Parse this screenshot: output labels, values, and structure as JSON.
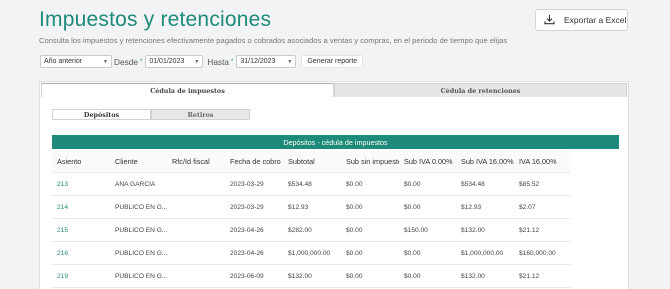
{
  "header": {
    "title": "Impuestos y retenciones",
    "subtitle": "Consulta los impuestos y retenciones efectivamente pagados o cobrados asociados a ventas y compras, en el periodo de tiempo que elijas",
    "export_label": "Exportar a Excel"
  },
  "filters": {
    "period_value": "Año anterior",
    "desde_label": "Desde",
    "desde_value": "01/01/2023",
    "hasta_label": "Hasta",
    "hasta_value": "31/12/2023",
    "required_mark": "*",
    "generate_label": "Generar reporte"
  },
  "tabs": [
    {
      "label": "Cédula de impuestos",
      "active": true
    },
    {
      "label": "Cédula de retenciones",
      "active": false
    }
  ],
  "subtabs": [
    {
      "label": "Depósitos",
      "active": true
    },
    {
      "label": "Retiros",
      "active": false
    }
  ],
  "table": {
    "title": "Depósitos - cédula de impuestos",
    "columns": [
      "Asiento",
      "Cliente",
      "Rfc/Id fiscal",
      "Fecha de cobro",
      "Subtotal",
      "Sub sin impuesto",
      "Sub IVA 0.00%",
      "Sub IVA 16.00%",
      "IVA 16.00%"
    ],
    "rows": [
      [
        "213",
        "ANA GARCÍA",
        "",
        "2023-03-29",
        "$534.48",
        "$0.00",
        "$0.00",
        "$534.48",
        "$85.52"
      ],
      [
        "214",
        "PÚBLICO EN G...",
        "",
        "2023-03-29",
        "$12.93",
        "$0.00",
        "$0.00",
        "$12.93",
        "$2.07"
      ],
      [
        "215",
        "PÚBLICO EN G...",
        "",
        "2023-04-26",
        "$282.00",
        "$0.00",
        "$150.00",
        "$132.00",
        "$21.12"
      ],
      [
        "216",
        "PÚBLICO EN G...",
        "",
        "2023-04-26",
        "$1,000,000.00",
        "$0.00",
        "$0.00",
        "$1,000,000.00",
        "$160,000.00"
      ],
      [
        "219",
        "PÚBLICO EN G...",
        "",
        "2023-06-09",
        "$132.00",
        "$0.00",
        "$0.00",
        "$132.00",
        "$21.12"
      ]
    ]
  },
  "colors": {
    "accent": "#1e8a79",
    "background": "#f2f3f4"
  },
  "icons": {
    "export": "download-icon",
    "dropdown": "chevron-down-icon"
  }
}
